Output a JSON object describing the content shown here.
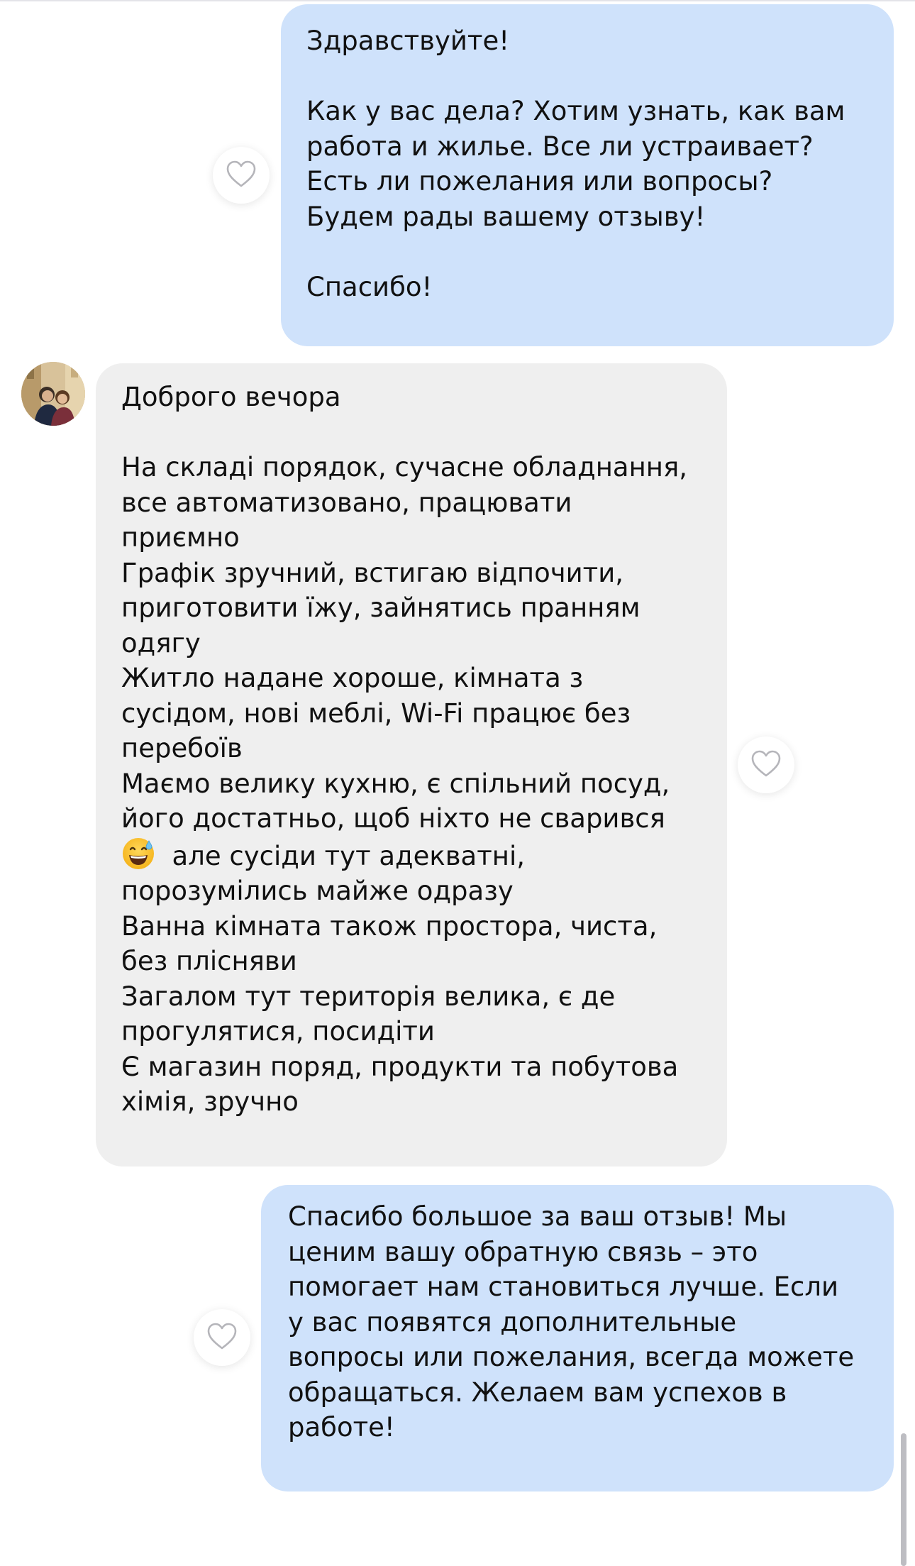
{
  "chat": {
    "messages": [
      {
        "direction": "outgoing",
        "text": "Здравствуйте!\n\nКак у вас дела? Хотим узнать, как вам\nработа и жилье. Все ли устраивает?\nЕсть ли пожелания или вопросы?\nБудем рады вашему отзыву!\n\nСпасибо!"
      },
      {
        "direction": "incoming",
        "text_part1": "Доброго вечора\n\nНа складі порядок, сучасне обладнання,\nвсе автоматизовано, працювати\nприємно\nГрафік зручний, встигаю відпочити,\nприготовити їжу, зайнятись пранням\nодягу\nЖитло надане хороше, кімната з\nсусідом, нові меблі, Wi-Fi працює без\nперебоїв\nМаємо велику кухню, є спільний посуд,\nйого достатньо, щоб ніхто не сварився\n",
        "emoji": "😅",
        "text_part2": "  але сусіди тут адекватні,\nпорозумілись майже одразу\nВанна кімната також простора, чиста,\nбез плісняви\nЗагалом тут територія велика, є де\nпрогулятися, посидіти\nЄ магазин поряд, продукти та побутова\nхімія, зручно"
      },
      {
        "direction": "outgoing",
        "text": "Спасибо большое за ваш отзыв! Мы\nценим вашу обратную связь – это\nпомогает нам становиться лучше. Если\nу вас появятся дополнительные\nвопросы или пожелания, всегда можете\nобращаться. Желаем вам успехов в\nработе!"
      }
    ]
  },
  "icons": {
    "like": "heart-outline-icon",
    "emoji": "grinning-face-with-sweat-emoji"
  },
  "colors": {
    "outgoing_bubble": "#cfe2fb",
    "incoming_bubble": "#efefef",
    "background": "#ffffff",
    "text": "#111111",
    "heart_stroke": "#b5b5ba"
  }
}
